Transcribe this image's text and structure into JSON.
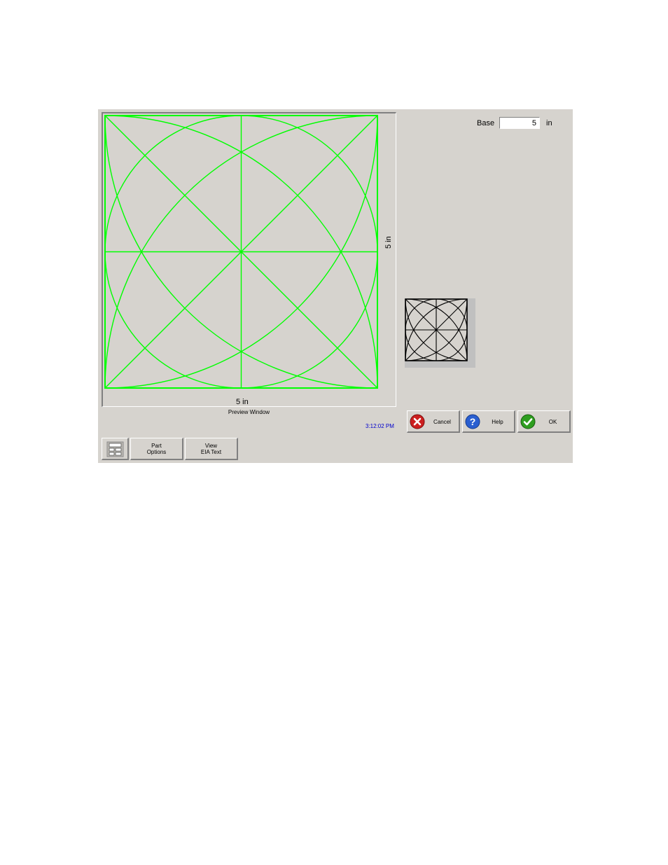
{
  "preview": {
    "caption": "Preview Window",
    "width_dimension": "5 in",
    "height_dimension": "5 in",
    "line_color": "#00ff00"
  },
  "base": {
    "label": "Base",
    "value": "5",
    "unit": "in"
  },
  "thumbnail": {
    "icon": "flower-shape-thumbnail"
  },
  "clock": "3:12:02 PM",
  "buttons": {
    "cancel": "Cancel",
    "help": "Help",
    "ok": "OK",
    "part_options_line1": "Part",
    "part_options_line2": "Options",
    "view_eia_line1": "View",
    "view_eia_line2": "EIA Text",
    "units_icon": "units-toggle-icon"
  },
  "colors": {
    "cancel_icon": "#cc1f1f",
    "help_icon": "#2a5fd0",
    "ok_icon": "#2e9e1f",
    "clock": "#0000cc"
  }
}
